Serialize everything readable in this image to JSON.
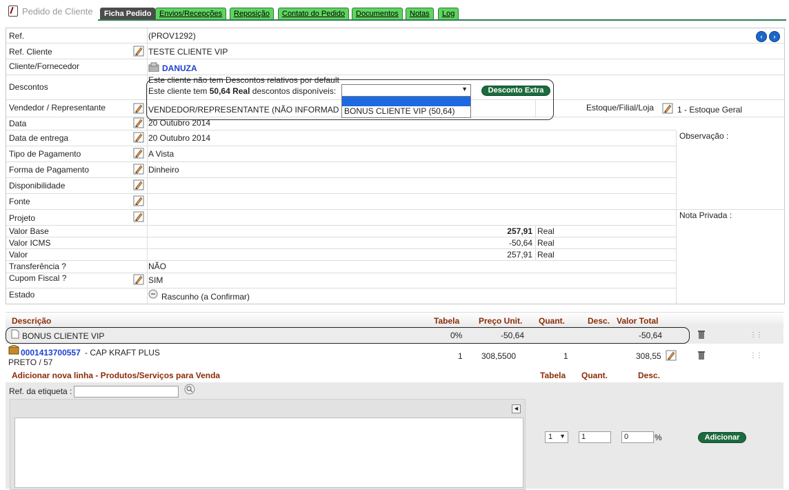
{
  "header": {
    "title": "Pedido de Cliente",
    "tabs": [
      {
        "label": "Ficha Pedido",
        "active": true
      },
      {
        "label": "Envios/Recepções"
      },
      {
        "label": "Reposição"
      },
      {
        "label": "Contato do Pedido"
      },
      {
        "label": "Documentos"
      },
      {
        "label": "Notas"
      },
      {
        "label": "Log"
      }
    ]
  },
  "form": {
    "ref_label": "Ref.",
    "ref_value": "(PROV1292)",
    "ref_cliente_label": "Ref. Cliente",
    "ref_cliente_value": "TESTE CLIENTE VIP",
    "cliente_label": "Cliente/Fornecedor",
    "cliente_value": "DANUZA",
    "descontos_label": "Descontos",
    "descontos_line1": "Este cliente não tem Descontos relativos por default",
    "descontos_line2_pre": "Este cliente tem ",
    "descontos_amount": "50,64 Real",
    "descontos_line2_post": " descontos disponíveis:",
    "desconto_extra_button": "Desconto Extra",
    "desconto_select_value": "",
    "desconto_option": "BONUS CLIENTE VIP (50,64)",
    "vendedor_label": "Vendedor / Representante",
    "vendedor_value": "VENDEDOR/REPRESENTANTE (NÃO INFORMAD",
    "estoque_label": "Estoque/Filial/Loja",
    "estoque_value": "1 - Estoque Geral",
    "data_label": "Data",
    "data_value": "20 Outubro 2014",
    "entrega_label": "Data de entrega",
    "entrega_value": "20 Outubro 2014",
    "tipo_pag_label": "Tipo de Pagamento",
    "tipo_pag_value": "A Vista",
    "forma_pag_label": "Forma de Pagamento",
    "forma_pag_value": "Dinheiro",
    "disponibilidade_label": "Disponibilidade",
    "fonte_label": "Fonte",
    "projeto_label": "Projeto",
    "valor_base_label": "Valor Base",
    "valor_base_value": "257,91",
    "valor_base_unit": "Real",
    "valor_icms_label": "Valor ICMS",
    "valor_icms_value": "-50,64",
    "valor_icms_unit": "Real",
    "valor_label": "Valor",
    "valor_value": "257,91",
    "valor_unit": "Real",
    "transferencia_label": "Transferência ?",
    "transferencia_value": "NÃO",
    "cupom_label": "Cupom Fiscal ?",
    "cupom_value": "SIM",
    "estado_label": "Estado",
    "estado_value": "Rascunho (a Confirmar)",
    "observacao_label": "Observação :",
    "nota_privada_label": "Nota Privada :"
  },
  "lines": {
    "headers": {
      "descricao": "Descrição",
      "tabela": "Tabela",
      "preco": "Preço Unit.",
      "quant": "Quant.",
      "desc": "Desc.",
      "total": "Valor Total"
    },
    "rows": [
      {
        "descricao": "BONUS CLIENTE VIP",
        "tabela": "0%",
        "preco": "-50,64",
        "quant": "",
        "total": "-50,64"
      },
      {
        "ref": "0001413700557",
        "descricao": " - CAP KRAFT PLUS",
        "descricao2": "PRETO / 57",
        "tabela": "1",
        "preco": "308,5500",
        "quant": "1",
        "total": "308,55"
      }
    ]
  },
  "add_line": {
    "title": "Adicionar nova linha - Produtos/Serviços para Venda",
    "h_tabela": "Tabela",
    "h_quant": "Quant.",
    "h_desc": "Desc.",
    "ref_etiqueta_label": "Ref. da etiqueta :",
    "tabela_value": "1",
    "quant_value": "1",
    "desc_value": "0",
    "percent": "%",
    "add_button": "Adicionar"
  },
  "colors": {
    "tab_green": "#5fd35f",
    "tab_active": "#4c4c4c",
    "button_green": "#1c6b3e",
    "link_blue": "#1d3fcf",
    "header_red": "#8a2c08"
  }
}
